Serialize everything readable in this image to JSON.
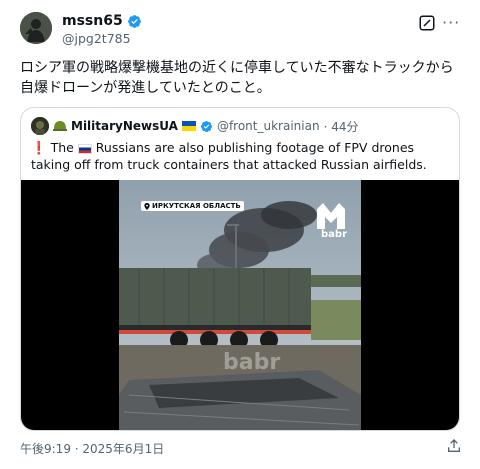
{
  "author": {
    "display_name": "mssn65",
    "handle": "@jpg2t785"
  },
  "tweet": {
    "text": "ロシア軍の戦略爆撃機基地の近くに停車していた不審なトラックから自爆ドローンが発進していたとのこと。",
    "timestamp": "午後9:19 · 2025年6月1日"
  },
  "quote": {
    "display_name": "MilitaryNewsUA",
    "handle": "@front_ukrainian",
    "time": "· 44分",
    "text_pre": "The",
    "text_post": "Russians are also publishing footage of FPV drones taking off from truck containers that attacked Russian airfields.",
    "video": {
      "location_label": "ИРКУТСКАЯ ОБЛАСТЬ",
      "logo_text": "babr",
      "watermark": "babr"
    }
  },
  "colors": {
    "verified": "#1d9bf0",
    "muted_text": "#536471",
    "border": "#cfd9de"
  },
  "icons": {
    "verified": "verified-badge-icon",
    "more": "more-dots-icon",
    "grok": "grok-icon",
    "share": "share-icon",
    "pin": "location-pin-icon"
  }
}
